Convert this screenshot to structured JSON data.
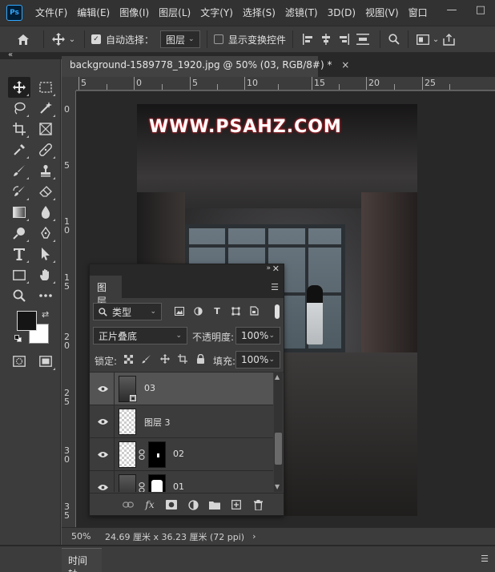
{
  "app": {
    "logo_text": "Ps",
    "menus": [
      "文件(F)",
      "编辑(E)",
      "图像(I)",
      "图层(L)",
      "文字(Y)",
      "选择(S)",
      "滤镜(T)",
      "3D(D)",
      "视图(V)",
      "窗口"
    ],
    "window_controls": [
      "—",
      "□"
    ]
  },
  "options_bar": {
    "home_icon": "home-icon",
    "move_icon": "move-tool-icon",
    "auto_select_label": "自动选择：",
    "auto_select_checked": true,
    "auto_select_target": "图层",
    "show_transform_label": "显示变换控件",
    "show_transform_checked": false
  },
  "document": {
    "tab_title": "background-1589778_1920.jpg @ 50% (03, RGB/8#) *",
    "close_glyph": "×",
    "watermark": "WWW.PSAHZ.COM",
    "ruler_h_labels": [
      "5",
      "0",
      "5",
      "10",
      "15",
      "20",
      "25"
    ],
    "ruler_v_labels": [
      "0",
      "5",
      "1 0",
      "1 5",
      "2 0",
      "2 5",
      "3 0",
      "3 5"
    ]
  },
  "status": {
    "zoom": "50%",
    "doc_size": "24.69 厘米 x 36.23 厘米 (72 ppi)",
    "arrow": "›"
  },
  "timeline": {
    "tab_label": "时间轴"
  },
  "layers_panel": {
    "tab_label": "图层",
    "filter_kind": "类型",
    "blend_mode": "正片叠底",
    "opacity_label": "不透明度:",
    "opacity_value": "100%",
    "lock_label": "锁定:",
    "fill_label": "填充:",
    "fill_value": "100%",
    "layers": [
      {
        "name": "03",
        "selected": true,
        "visible": true
      },
      {
        "name": "图层 3",
        "selected": false,
        "visible": true
      },
      {
        "name": "02",
        "selected": false,
        "visible": true
      },
      {
        "name": "01",
        "selected": false,
        "visible": true
      }
    ],
    "footer_fx": "fx"
  },
  "colors": {
    "accent": "#31a8ff",
    "watermark_glow": "#d1202a",
    "panel_bg": "#3c3c3c",
    "canvas_bg": "#282828"
  }
}
